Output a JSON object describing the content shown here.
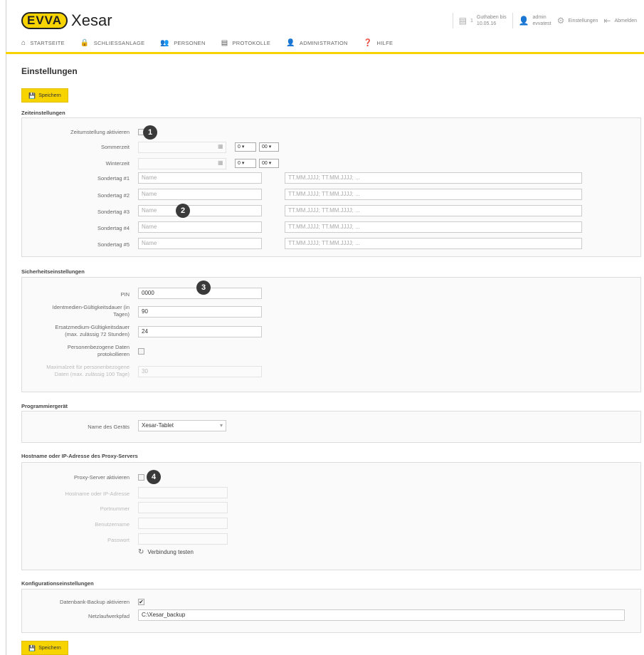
{
  "brand": {
    "evva": "EVVA",
    "product": "Xesar"
  },
  "topbar": {
    "guthaben_line1": "Guthaben bis",
    "guthaben_line2": "10.05.16",
    "guthaben_count": "1",
    "user_line1": "admin",
    "user_line2": "evvatest",
    "settings_label": "Einstellungen",
    "logout_label": "Abmelden"
  },
  "nav": {
    "items": [
      "STARTSEITE",
      "SCHLIESSANLAGE",
      "PERSONEN",
      "PROTOKOLLE",
      "ADMINISTRATION",
      "HILFE"
    ]
  },
  "page": {
    "title": "Einstellungen",
    "save_label": "Speichern"
  },
  "zeit": {
    "section": "Zeiteinstellungen",
    "activate_label": "Zeitumstellung aktivieren",
    "summer_label": "Sommerzeit",
    "winter_label": "Winterzeit",
    "hour_value": "0",
    "minute_value": "00",
    "special_days": [
      {
        "label": "Sondertag #1",
        "name_ph": "Name",
        "dates_ph": "TT.MM.JJJJ; TT.MM.JJJJ; ..."
      },
      {
        "label": "Sondertag #2",
        "name_ph": "Name",
        "dates_ph": "TT.MM.JJJJ; TT.MM.JJJJ; ..."
      },
      {
        "label": "Sondertag #3",
        "name_ph": "Name",
        "dates_ph": "TT.MM.JJJJ; TT.MM.JJJJ; ..."
      },
      {
        "label": "Sondertag #4",
        "name_ph": "Name",
        "dates_ph": "TT.MM.JJJJ; TT.MM.JJJJ; ..."
      },
      {
        "label": "Sondertag #5",
        "name_ph": "Name",
        "dates_ph": "TT.MM.JJJJ; TT.MM.JJJJ; ..."
      }
    ]
  },
  "security": {
    "section": "Sicherheitseinstellungen",
    "pin_label": "PIN",
    "pin_value": "0000",
    "ident_label_1": "Identmedien-Gültigkeitsdauer (in",
    "ident_label_2": "Tagen)",
    "ident_value": "90",
    "ersatz_label_1": "Ersatzmedium-Gültigkeitsdauer",
    "ersatz_label_2": "(max. zulässig 72 Stunden)",
    "ersatz_value": "24",
    "personen_label_1": "Personenbezogene Daten",
    "personen_label_2": "protokollieren",
    "max_label_1": "Maximalzeit für personenbezogene",
    "max_label_2": "Daten (max. zulässig 100 Tage)",
    "max_value": "30"
  },
  "programmer": {
    "section": "Programmiergerät",
    "device_label": "Name des Geräts",
    "device_value": "Xesar-Tablet"
  },
  "proxy": {
    "section": "Hostname oder IP-Adresse des Proxy-Servers",
    "activate_label": "Proxy-Server aktivieren",
    "host_label": "Hostname oder IP-Adresse",
    "port_label": "Portnummer",
    "user_label": "Benutzername",
    "password_label": "Passwort",
    "test_label": "Verbindung testen"
  },
  "config": {
    "section": "Konfigurationseinstellungen",
    "backup_label": "Datenbank-Backup aktivieren",
    "path_label": "Netzlaufwerkpfad",
    "path_value": "C:\\Xesar_backup"
  },
  "badges": [
    "1",
    "2",
    "3",
    "4"
  ],
  "colors": {
    "accent": "#f7d300",
    "badge": "#3a3a3a"
  }
}
